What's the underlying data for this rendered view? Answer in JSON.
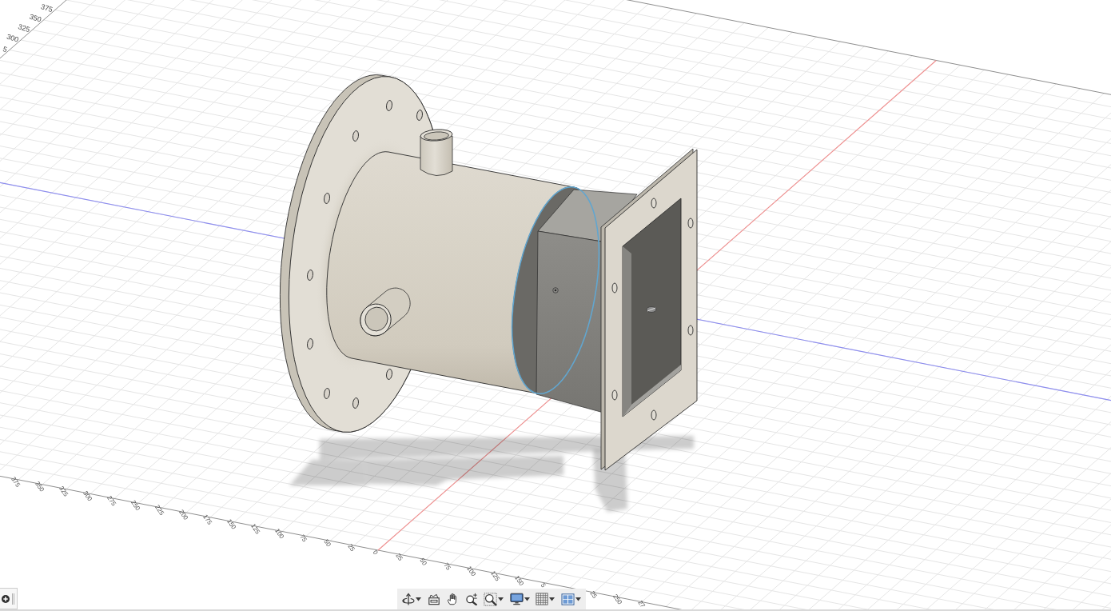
{
  "viewport": {
    "near_edge_ruler": {
      "left_labels": [
        "375",
        "350",
        "325",
        "300",
        "275",
        "250",
        "225",
        "200",
        "175",
        "150",
        "125",
        "100",
        "75",
        "50",
        "25"
      ],
      "zero_label": "0",
      "right_labels": [
        "25",
        "50",
        "75",
        "100",
        "125",
        "150",
        "5"
      ],
      "labels_right_of_toolbar": [
        "25",
        "250",
        "27"
      ]
    },
    "left_edge_ruler": {
      "labels": [
        "375",
        "350",
        "325",
        "300",
        "5"
      ]
    }
  }
}
